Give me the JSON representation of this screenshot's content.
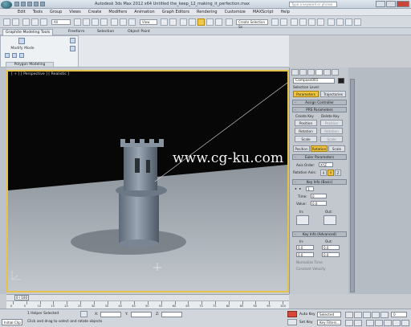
{
  "window": {
    "title": "Autodesk 3ds Max 2012 x64   Untitled   the_keep_12_making_it_perfection.max",
    "search_placeholder": "Type a keyword or phrase"
  },
  "menu": [
    "Edit",
    "Tools",
    "Group",
    "Views",
    "Create",
    "Modifiers",
    "Animation",
    "Graph Editors",
    "Rendering",
    "Customize",
    "MAXScript",
    "Help"
  ],
  "toolbar": {
    "filter_label": "All",
    "view_label": "View",
    "selection_set_placeholder": "Create Selection Se"
  },
  "ribbon": {
    "tabs": [
      "Graphite Modeling Tools",
      "Freeform",
      "Selection",
      "Object Paint"
    ],
    "mode_label": "Modify Mode",
    "group_label": "Polygon Modeling"
  },
  "viewport": {
    "label": "[ + ] [ Perspective ] [ Realistic ]",
    "watermark": "www.cg-ku.com",
    "accent_color": "#e7c24a"
  },
  "command_panel": {
    "object_name": "Compass001",
    "selection_level_label": "Selection Level:",
    "sel_tabs": [
      "Parameters",
      "Trajectories"
    ],
    "rollouts": {
      "assign_controller": "Assign Controller",
      "pr_parameters": "PRS Parameters",
      "euler_parameters": "Euler Parameters",
      "key_info_basic": "Key Info (Basic)",
      "key_info_advanced": "Key Info (Advanced)"
    },
    "create_key_label": "Create Key",
    "delete_key_label": "Delete Key",
    "keys": [
      "Position",
      "Rotation",
      "Scale"
    ],
    "prs_tabs": [
      "Position",
      "Rotation",
      "Scale"
    ],
    "axis_order_label": "Axis Order:",
    "axis_order_value": "XYZ",
    "rotation_axis_label": "Rotation Axis:",
    "rotation_axes": [
      "X",
      "Y",
      "Z"
    ],
    "key_nav_value": "1",
    "time_label": "Time:",
    "value_label": "Value:",
    "time_value": "0",
    "value_value": "0.0",
    "in_label": "In:",
    "out_label": "Out:",
    "adv_in_label": "In:",
    "adv_out_label": "Out:",
    "adv_in_value": "0.0",
    "adv_out_value": "0.0",
    "normalize_label": "Normalize Time",
    "constant_label": "Constant Velocity"
  },
  "time_slider": {
    "current": "0 / 100",
    "ticks": [
      "0",
      "5",
      "10",
      "15",
      "20",
      "25",
      "30",
      "35",
      "40",
      "45",
      "50",
      "55",
      "60",
      "65",
      "70",
      "75",
      "80",
      "85",
      "90",
      "95",
      "100"
    ]
  },
  "status": {
    "maxscript_label": "Initial Clip",
    "selected_text": "1 Helper Selected",
    "prompt_text": "Click and drag to select and rotate objects",
    "x_label": "X:",
    "y_label": "Y:",
    "z_label": "Z:",
    "auto_key_label": "Auto Key",
    "set_key_label": "Set Key",
    "selected_dropdown": "Selected",
    "key_filters_label": "Key Filters...",
    "frame_value": "0"
  }
}
